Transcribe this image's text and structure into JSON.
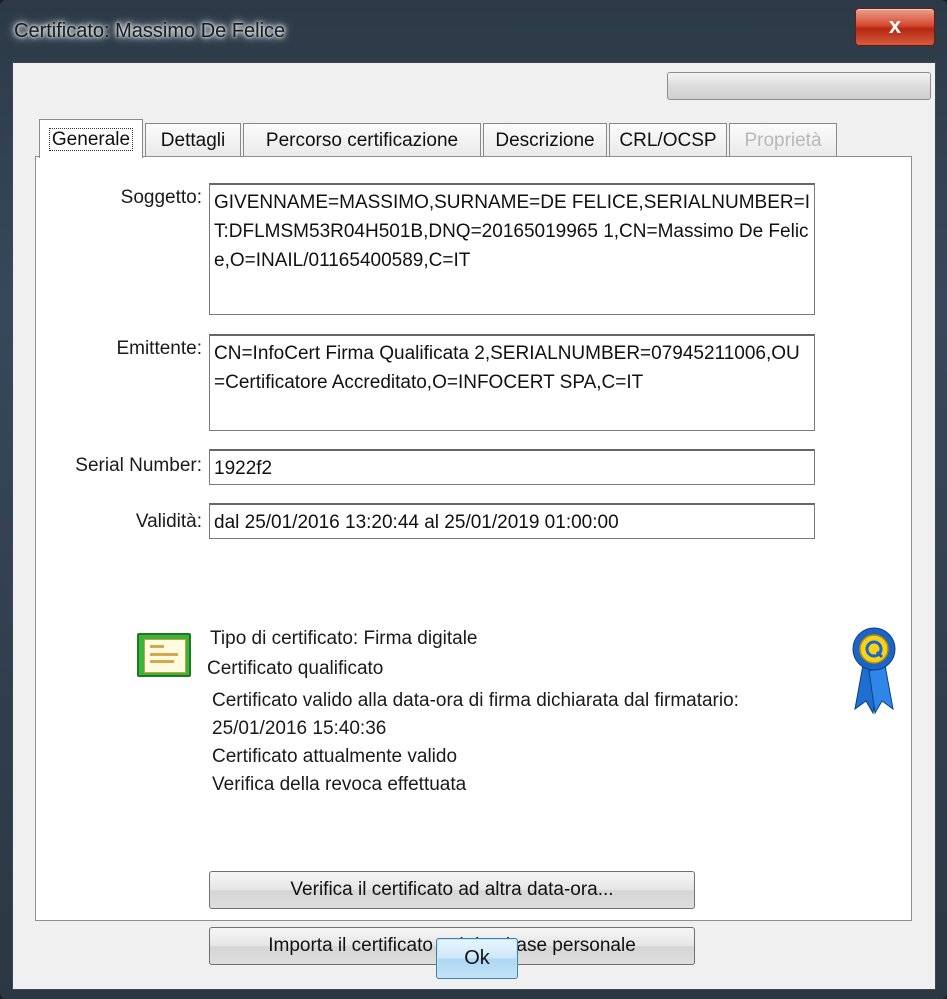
{
  "window": {
    "title": "Certificato: Massimo De Felice",
    "close_label": "x"
  },
  "tabs": [
    {
      "label": "Generale",
      "state": "selected"
    },
    {
      "label": "Dettagli"
    },
    {
      "label": "Percorso certificazione"
    },
    {
      "label": "Descrizione"
    },
    {
      "label": "CRL/OCSP"
    },
    {
      "label": "Proprietà",
      "state": "disabled"
    }
  ],
  "fields": {
    "subject": {
      "label": "Soggetto:",
      "value": "GIVENNAME=MASSIMO,SURNAME=DE FELICE,SERIALNUMBER=IT:DFLMSM53R04H501B,DNQ=20165019965 1,CN=Massimo De Felice,O=INAIL/01165400589,C=IT"
    },
    "issuer": {
      "label": "Emittente:",
      "value": "CN=InfoCert Firma Qualificata 2,SERIALNUMBER=07945211006,OU=Certificatore Accreditato,O=INFOCERT SPA,C=IT"
    },
    "serial": {
      "label": "Serial Number:",
      "value": "1922f2"
    },
    "validity": {
      "label": "Validità:",
      "value": "dal 25/01/2016 13:20:44 al 25/01/2019 01:00:00"
    }
  },
  "info": {
    "type": "Tipo di certificato: Firma digitale",
    "qualified": "Certificato qualificato",
    "valid_at_line1": "Certificato valido alla data-ora di firma dichiarata dal firmatario:",
    "valid_at_line2": "25/01/2016 15:40:36",
    "currently_valid": "Certificato attualmente valido",
    "revocation": "Verifica della revoca effettuata"
  },
  "icons": {
    "certificate": "certificate-icon",
    "qualified_badge": "qualified-ribbon-icon"
  },
  "buttons": {
    "verify_other_date": "Verifica il certificato ad altra data-ora...",
    "import_cert": "Importa il certificato nel database personale",
    "ok": "Ok"
  }
}
